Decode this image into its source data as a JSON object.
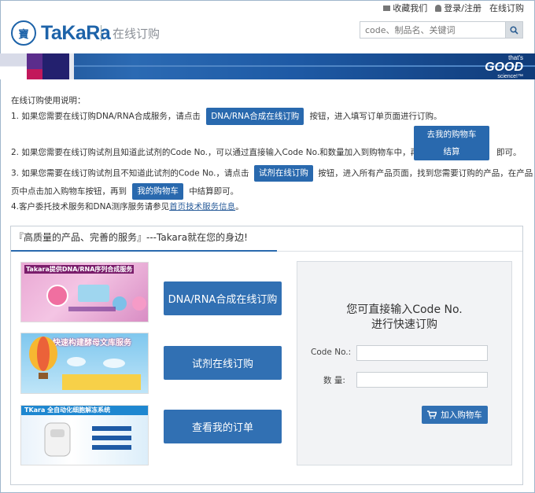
{
  "header": {
    "links": {
      "favorite": "收藏我们",
      "login": "登录/注册",
      "online_order": "在线订购"
    },
    "logo_text": "TaKaRa",
    "logo_mark": "寶",
    "title": "在线订购",
    "search_placeholder": "code、制品名、关键词"
  },
  "banner": {
    "line1": "that's",
    "line2": "GOOD",
    "line3": "science!™"
  },
  "instructions": {
    "heading": "在线订购使用说明：",
    "l1_a": "1. 如果您需要在线订购DNA/RNA合成服务，请点击",
    "l1_btn": "DNA/RNA合成在线订购",
    "l1_b": "按钮，进入填写订单页面进行订购。",
    "l2_a": "2. 如果您需要在线订购试剂且知道此试剂的Code  No.，可以通过直接输入Code No.和数量加入到购物车中，再点击",
    "l2_btn1": "去我的购物车",
    "l2_btn2": "结算",
    "l2_b": "即可。",
    "l3_a": "3. 如果您需要在线订购试剂且不知道此试剂的Code  No.，请点击",
    "l3_btn": "试剂在线订购",
    "l3_b": "按钮，进入所有产品页面，找到您需要订购的产品，在产品",
    "l3c_a": "页中点击加入购物车按钮，再到",
    "l3c_btn": "我的购物车",
    "l3c_b": "中结算即可。",
    "l4_a": "4.客户委托技术服务和DNA测序服务请参见",
    "l4_link": "首页技术服务信息",
    "l4_b": "。"
  },
  "panel": {
    "title": "『高质量的产品、完善的服务』---Takara就在您的身边!",
    "thumbs": [
      {
        "caption": "Takara提供DNA/RNA序列合成服务"
      },
      {
        "caption": "快速构建酵母文库服务"
      },
      {
        "caption": "TKara 全自动化细胞解冻系统"
      }
    ],
    "buttons": {
      "dna_rna": "DNA/RNA合成在线订购",
      "reagent": "试剂在线订购",
      "orders": "查看我的订单"
    },
    "quick": {
      "title_line1": "您可直接输入Code  No.",
      "title_line2": "进行快速订购",
      "code_label": "Code  No.:",
      "qty_label": "数    量:",
      "cart_button": "加入购物车"
    }
  },
  "colors": {
    "primary_button": "#2969ae",
    "brand_blue": "#1d63a9"
  }
}
